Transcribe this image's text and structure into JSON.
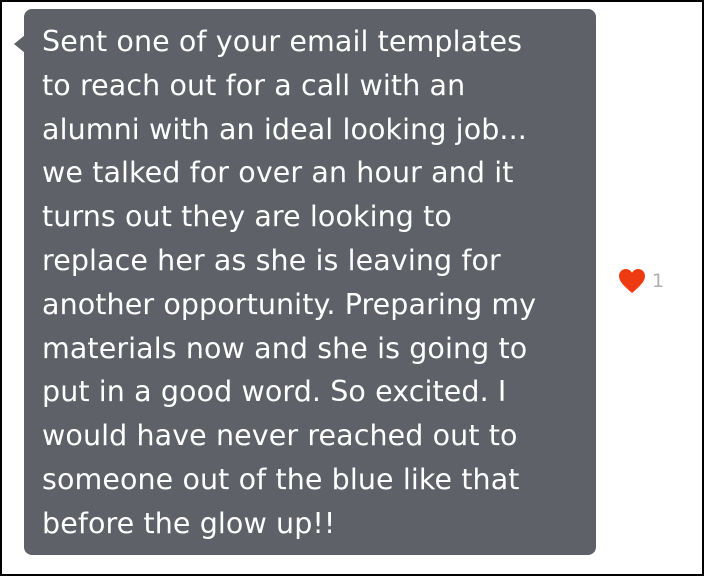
{
  "message": {
    "lines": [
      "Sent one of your email templates",
      "to reach out for a call with an",
      "alumni with an ideal looking job...",
      "we talked for over an hour and it",
      "turns out they are looking to",
      "replace her as she is leaving for",
      "another opportunity. Preparing my",
      "materials now and she is going to",
      "put in a good word. So excited. I",
      "would have never reached out to",
      "someone out of the blue like that",
      "before the glow up!!"
    ],
    "bubble_color": "#5e6268",
    "text_color": "#ffffff"
  },
  "reaction": {
    "icon": "heart-icon",
    "color": "#ee3a10",
    "count": "1"
  }
}
